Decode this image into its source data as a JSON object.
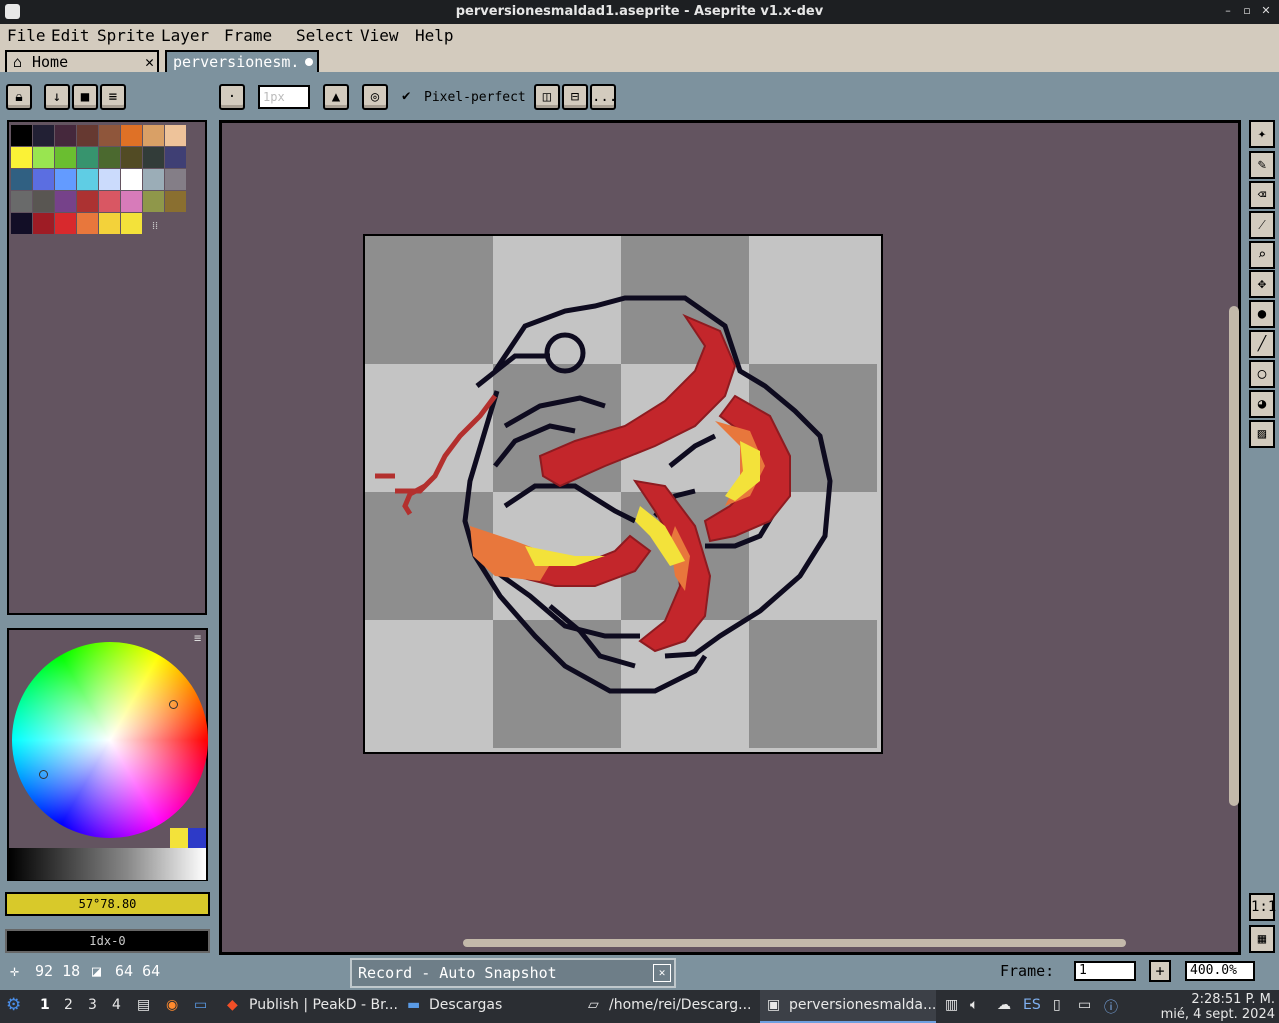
{
  "window": {
    "title": "perversionesmaldad1.aseprite - Aseprite v1.x-dev"
  },
  "menu": [
    "File",
    "Edit",
    "Sprite",
    "Layer",
    "Frame",
    "Select",
    "View",
    "Help"
  ],
  "tabs": [
    {
      "label": "Home"
    },
    {
      "label": "perversionesm."
    }
  ],
  "toolbar": {
    "brush_size_value": "1px",
    "pixel_perfect_label": "Pixel-perfect",
    "more_label": "..."
  },
  "palette": {
    "colors": [
      "#000000",
      "#222034",
      "#45283c",
      "#663931",
      "#8f563b",
      "#df7126",
      "#d9a066",
      "#eec39a",
      "#fbf236",
      "#99e550",
      "#6abe30",
      "#37946e",
      "#4b692f",
      "#524b24",
      "#323c39",
      "#3f3f74",
      "#306082",
      "#5b6ee1",
      "#639bff",
      "#5fcde4",
      "#cbdbfc",
      "#ffffff",
      "#9badb7",
      "#847e87",
      "#696a6a",
      "#595652",
      "#76428a",
      "#ac3232",
      "#d95763",
      "#d77bba",
      "#8f974a",
      "#8a6f30",
      "#120e26",
      "#9e1c25",
      "#d8292d",
      "#e8773c",
      "#f3d23a",
      "#f3e23a"
    ]
  },
  "colors": {
    "foreground": "57°78.80",
    "background": "Idx-0"
  },
  "status": {
    "cursor": "92 18",
    "size": "64 64",
    "notice": "Record - Auto Snapshot",
    "frame_label": "Frame:",
    "frame_value": "1",
    "zoom": "400.0%"
  },
  "taskbar": {
    "workspaces": [
      "1",
      "2",
      "3",
      "4"
    ],
    "apps": [
      "Publish | PeakD - Br...",
      "Descargas",
      "/home/rei/Descarg...",
      "perversionesmalda..."
    ],
    "lang": "ES",
    "time": "2:28:51 P. M.",
    "date": "mié, 4 sept. 2024"
  }
}
